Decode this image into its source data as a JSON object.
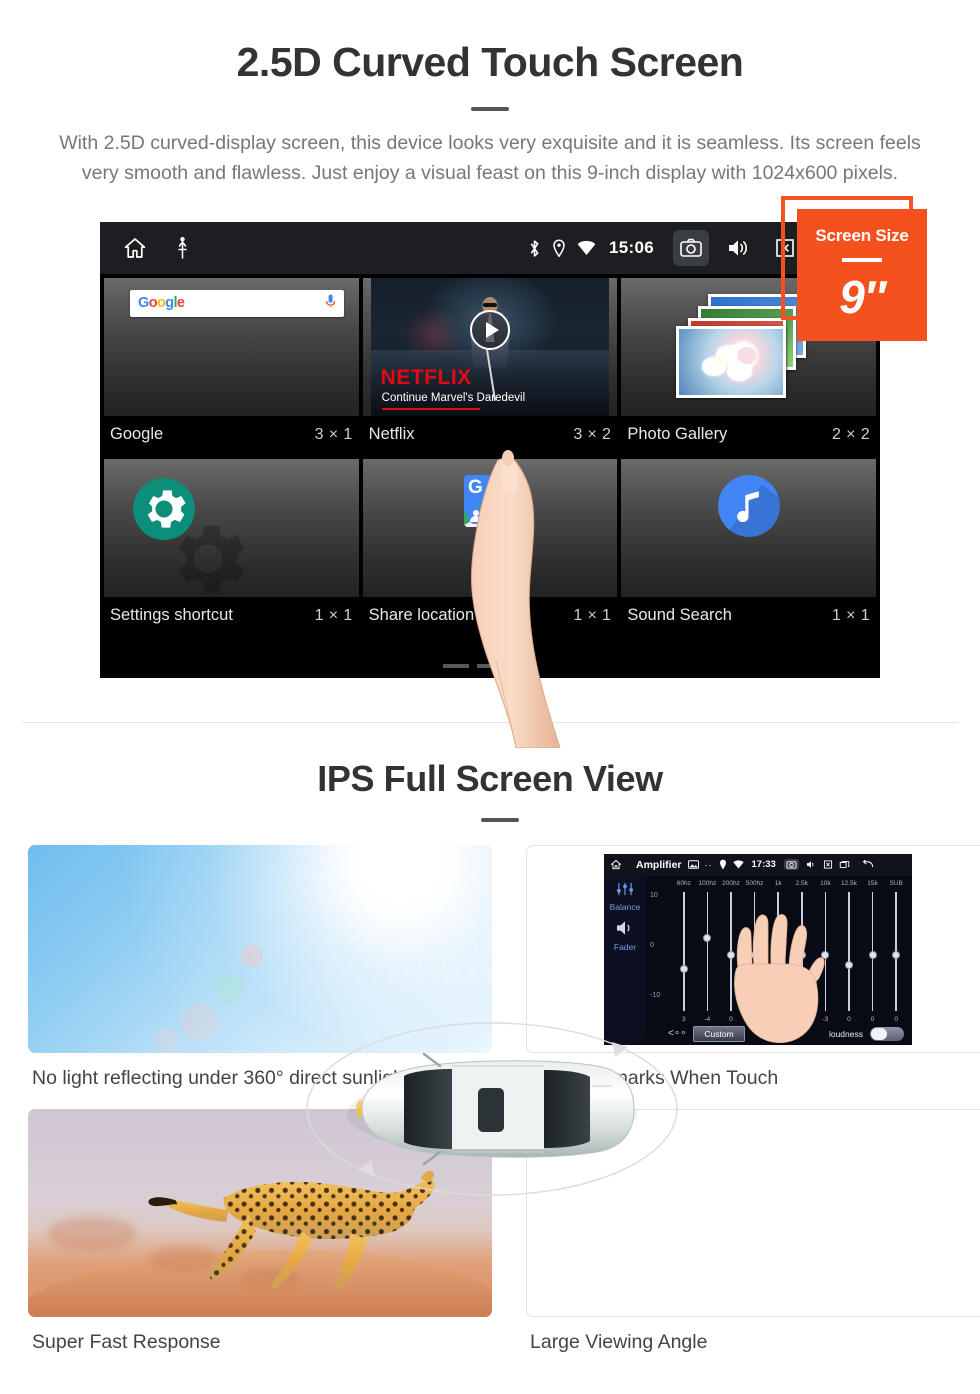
{
  "section1": {
    "title": "2.5D Curved Touch Screen",
    "description": "With 2.5D curved-display screen, this device looks very exquisite and it is seamless. Its screen feels very smooth and flawless. Just enjoy a visual feast on this 9-inch display with 1024x600 pixels."
  },
  "badge": {
    "title": "Screen Size",
    "value": "9″",
    "color": "#f4511e"
  },
  "android_screen": {
    "statusbar": {
      "home_icon": "home-icon",
      "usb_icon": "usb-icon",
      "bluetooth_icon": "bluetooth-icon",
      "location_icon": "location-pin-icon",
      "wifi_icon": "wifi-icon",
      "time": "15:06",
      "camera_icon": "camera-icon",
      "volume_icon": "volume-icon",
      "close_icon": "close-box-icon",
      "recents_icon": "recent-apps-icon"
    },
    "widgets": [
      {
        "name": "Google",
        "size": "3 × 1",
        "preview": "google-search-bar",
        "search_logo": "Google",
        "mic_icon": "mic-icon"
      },
      {
        "name": "Netflix",
        "size": "3 × 2",
        "preview": "netflix-continue-watching",
        "brand": "NETFLIX",
        "subtitle": "Continue Marvel's Daredevil",
        "play_icon": "play-icon"
      },
      {
        "name": "Photo Gallery",
        "size": "2 × 2",
        "preview": "photo-stack"
      },
      {
        "name": "Settings shortcut",
        "size": "1 × 1",
        "preview": "gear-icon"
      },
      {
        "name": "Share location",
        "size": "1 × 1",
        "preview": "google-maps-icon"
      },
      {
        "name": "Sound Search",
        "size": "1 × 1",
        "preview": "music-note-icon"
      }
    ],
    "page_dots": {
      "count": 3,
      "active_index": 2
    }
  },
  "section2": {
    "title": "IPS Full Screen View",
    "items": [
      {
        "caption": "No light reflecting under 360° direct sunlight",
        "media": "blue-sky-sun-flare"
      },
      {
        "caption": "No Watermarks When Touch",
        "media": "amplifier-equalizer-screenshot"
      },
      {
        "caption": "Super Fast Response",
        "media": "running-cheetah-photo"
      },
      {
        "caption": "Large Viewing Angle",
        "media": "car-top-view-rotation"
      }
    ]
  },
  "amplifier": {
    "title": "Amplifier",
    "time": "17:33",
    "side_buttons": [
      {
        "label": "Balance",
        "icon": "sliders-icon"
      },
      {
        "label": "Fader",
        "icon": "speaker-icon"
      }
    ],
    "scale_labels": [
      "10",
      "0",
      "-10"
    ],
    "bands": [
      "60hz",
      "100hz",
      "200hz",
      "500hz",
      "1k",
      "2.5k",
      "10k",
      "12.5k",
      "15k",
      "SUB"
    ],
    "values": [
      "3",
      "-4",
      "0",
      "0",
      "-3",
      "0",
      "-3",
      "0",
      "0",
      "0"
    ],
    "preset": "Custom",
    "loudness_label": "loudness",
    "back_icon": "back-arrow-icon"
  }
}
